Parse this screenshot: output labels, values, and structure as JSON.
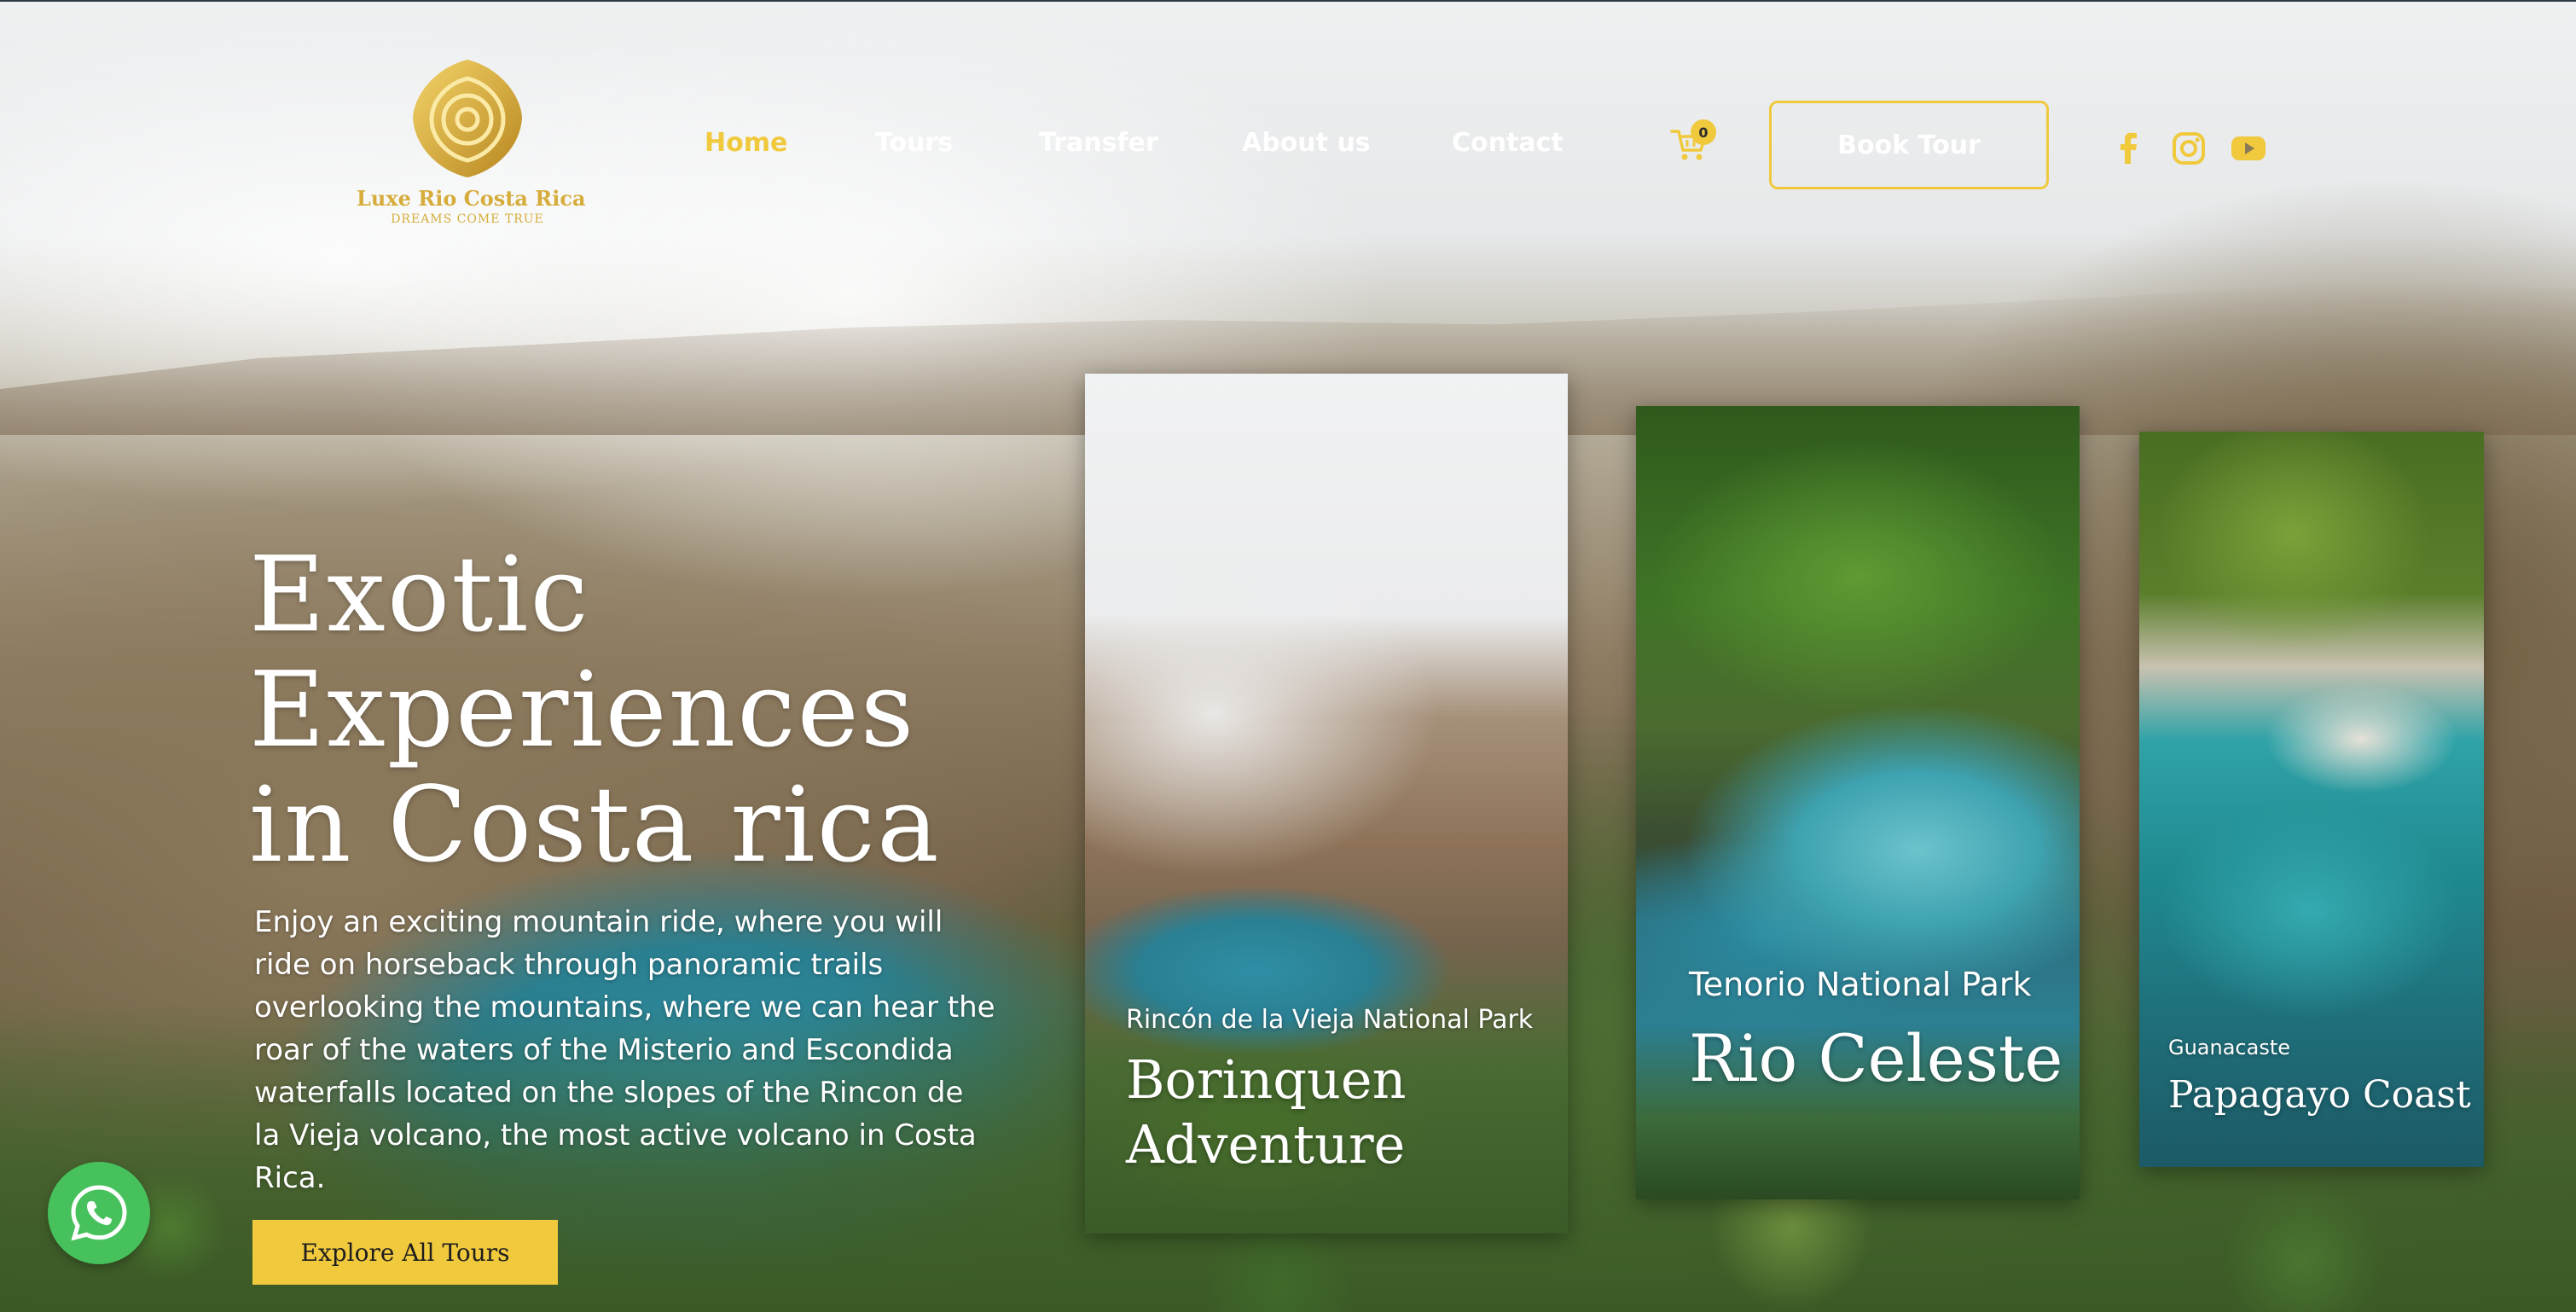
{
  "brand": {
    "name": "Luxe Rio Costa Rica",
    "tagline": "DREAMS COME TRUE"
  },
  "nav": {
    "items": [
      {
        "label": "Home",
        "active": true
      },
      {
        "label": "Tours"
      },
      {
        "label": "Transfer"
      },
      {
        "label": "About us"
      },
      {
        "label": "Contact"
      }
    ]
  },
  "cart": {
    "count": "0",
    "icon": "cart-icon"
  },
  "header": {
    "book_label": "Book Tour"
  },
  "social": [
    "facebook-icon",
    "instagram-icon",
    "youtube-icon"
  ],
  "hero": {
    "title_lines": [
      "Exotic",
      "Experiences",
      "in Costa rica"
    ],
    "description": "Enjoy an exciting mountain ride, where you will ride on horseback through panoramic trails overlooking the mountains, where we can hear the roar of the waters of the Misterio and Escondida waterfalls located on the slopes of the Rincon de la Vieja volcano, the most active volcano in Costa Rica.",
    "cta_label": "Explore All Tours"
  },
  "cards": [
    {
      "subtitle": "Rincón de la Vieja National Park",
      "title": "Borinquen Adventure"
    },
    {
      "subtitle": "Tenorio National Park",
      "title": "Rio Celeste"
    },
    {
      "subtitle": "Guanacaste",
      "title": "Papagayo Coast"
    }
  ],
  "colors": {
    "accent": "#f0c93d",
    "logo_gold": "#d6ad3c",
    "whatsapp": "#46c15c"
  },
  "floating": {
    "whatsapp_icon": "whatsapp-icon"
  }
}
